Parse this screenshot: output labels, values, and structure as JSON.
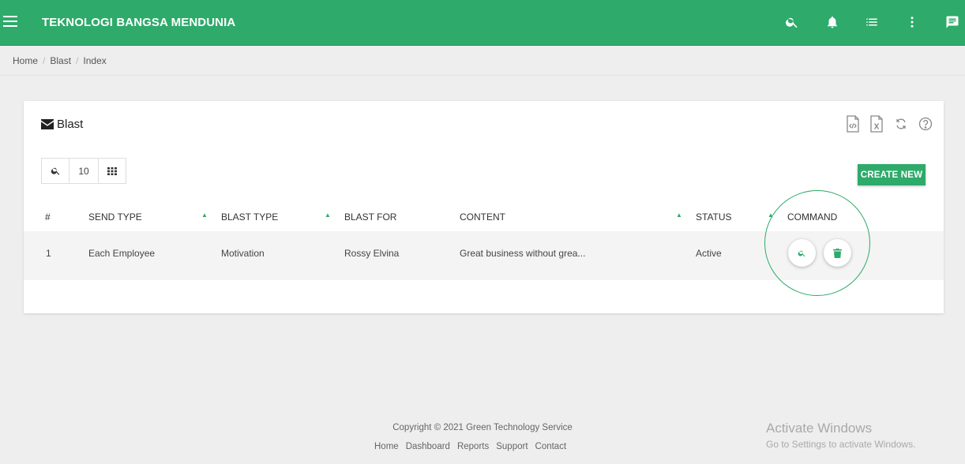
{
  "header": {
    "title": "TEKNOLOGI BANGSA MENDUNIA",
    "icons": [
      "menu-icon",
      "search-icon",
      "bell-icon",
      "list-icon",
      "more-vert-icon",
      "chat-icon"
    ],
    "bg_color": "#2eaa6a"
  },
  "breadcrumb": [
    "Home",
    "Blast",
    "Index"
  ],
  "card": {
    "title": "Blast",
    "toolbar_icons": [
      "export-html-icon",
      "export-excel-icon",
      "refresh-icon",
      "help-icon"
    ],
    "page_size": "10",
    "create_label": "CREATE NEW"
  },
  "table": {
    "columns": [
      "#",
      "SEND TYPE",
      "BLAST TYPE",
      "BLAST FOR",
      "CONTENT",
      "STATUS",
      "COMMAND"
    ],
    "rows": [
      {
        "no": "1",
        "send_type": "Each Employee",
        "blast_type": "Motivation",
        "blast_for": "Rossy Elvina",
        "content": "Great business without grea...",
        "status": "Active"
      }
    ]
  },
  "footer": {
    "copyright": "Copyright © 2021 Green Technology Service",
    "links": [
      "Home",
      "Dashboard",
      "Reports",
      "Support",
      "Contact"
    ]
  },
  "watermark": {
    "title": "Activate Windows",
    "subtitle": "Go to Settings to activate Windows."
  },
  "accent_color": "#2eaa6a"
}
